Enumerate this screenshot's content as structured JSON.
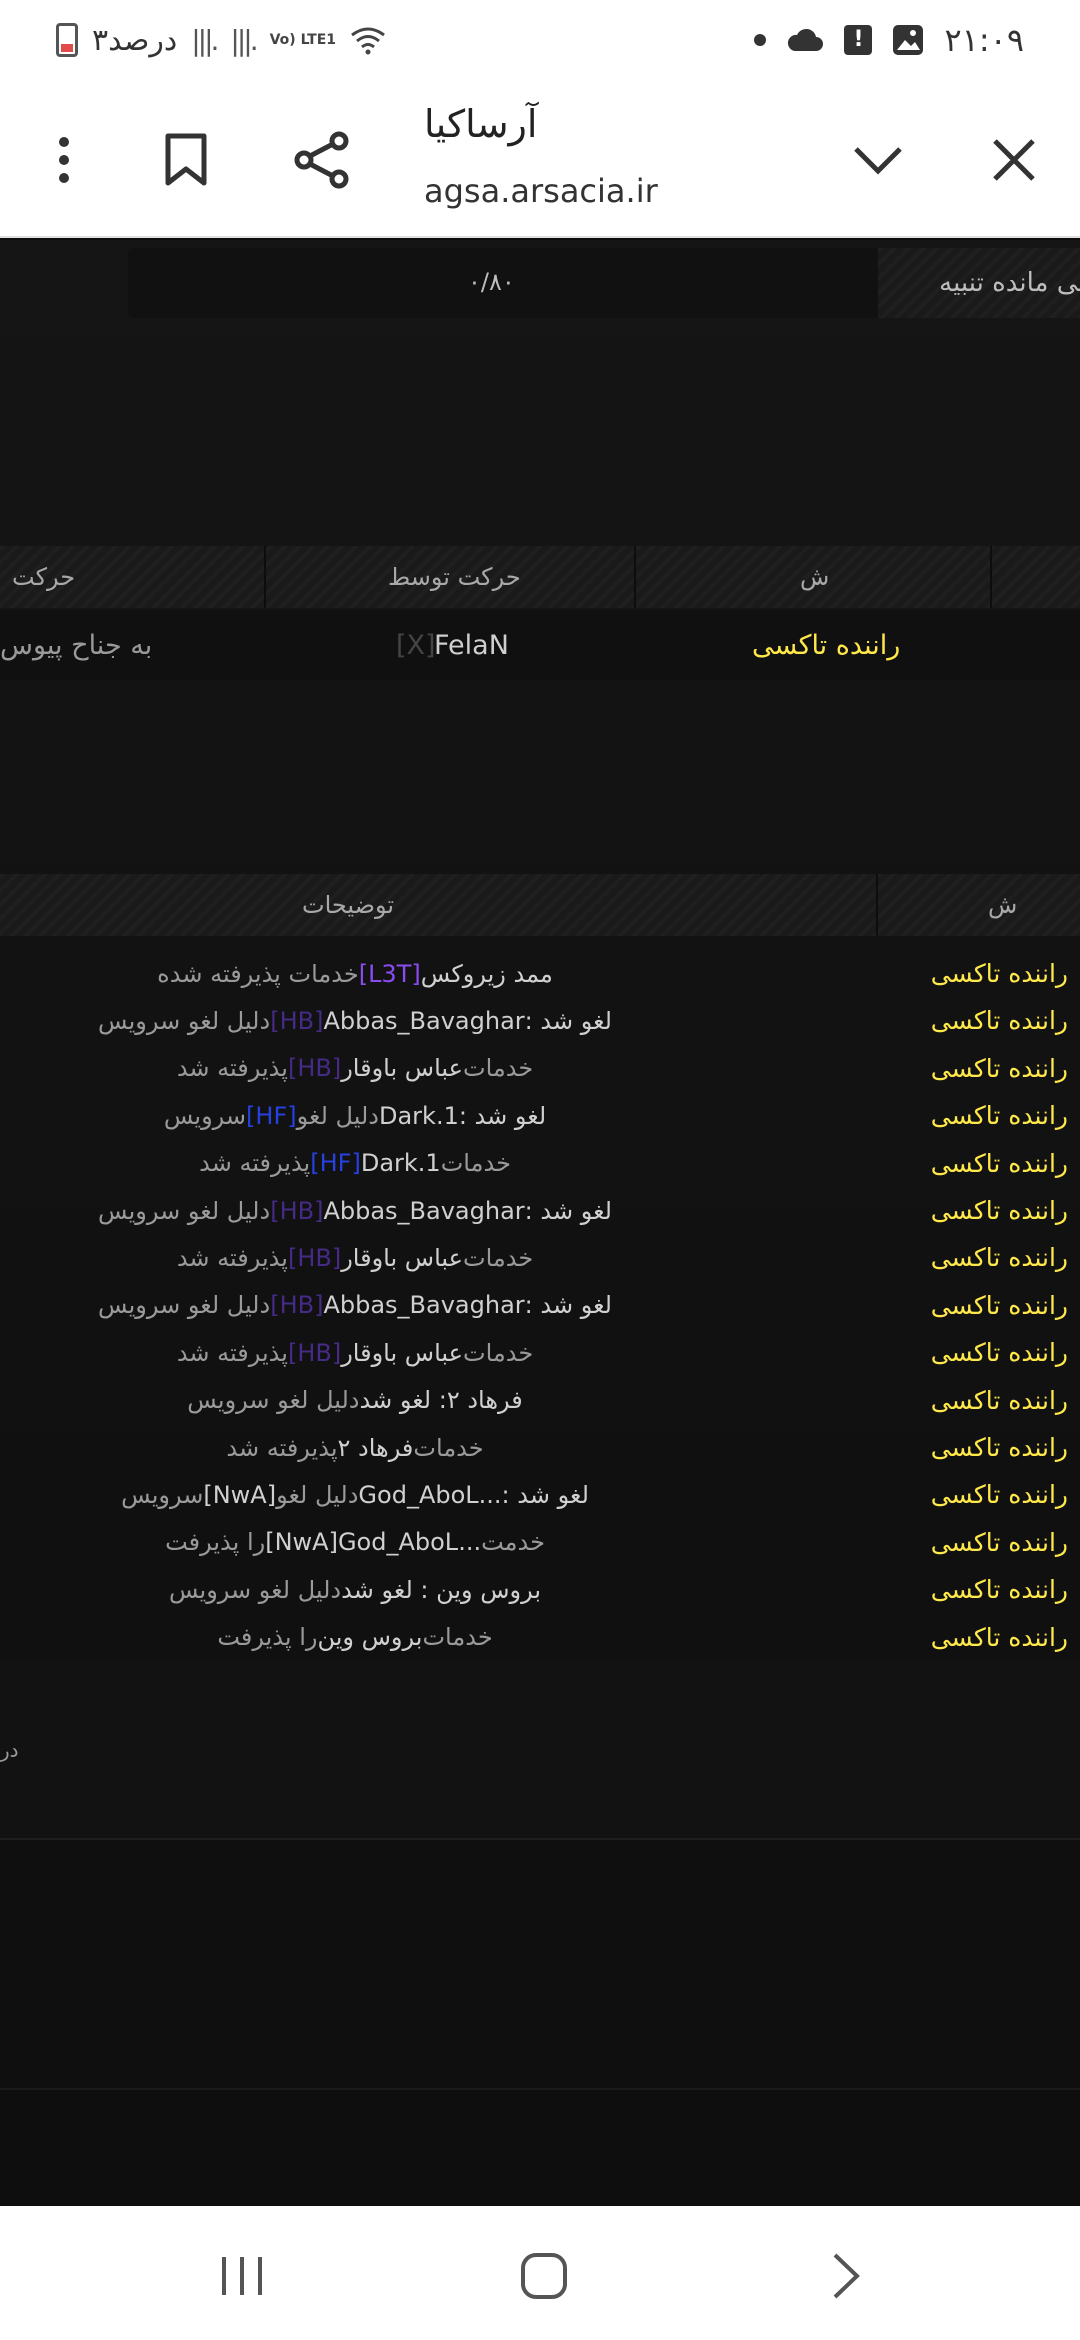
{
  "status_bar": {
    "battery_text": "۳درصد",
    "network": "Vo) LTE1",
    "time": "۲۱:۰۹",
    "icons": [
      "battery-icon",
      "signal-icon",
      "wifi-icon",
      "cloud-icon",
      "alert-icon",
      "gallery-icon"
    ]
  },
  "browser": {
    "title": "آرساکیا",
    "url": "agsa.arsacia.ir",
    "icons": [
      "more-icon",
      "bookmark-icon",
      "share-icon",
      "chevron-down-icon",
      "close-icon"
    ]
  },
  "warning": {
    "label": "باقی مانده تنبیه",
    "value": "۰/۸۰"
  },
  "table1": {
    "headers": {
      "rank": "ش",
      "moved_by": "حرکت توسط",
      "action": "حرکت"
    },
    "row": {
      "rank": "راننده تاکسی",
      "tag": "[X]",
      "name": "FelaN",
      "action": "به جناح پیوس"
    }
  },
  "table2": {
    "headers": {
      "rank": "ش",
      "description": "توضیحات"
    },
    "rows": [
      {
        "role": "راننده تاکسی",
        "parts": [
          {
            "t": "ممد زیروکس ",
            "c": "nm"
          },
          {
            "t": "[L3T]",
            "c": "tg-purple"
          },
          {
            "t": " خدمات پذیرفته شده",
            "c": ""
          }
        ]
      },
      {
        "role": "راننده تاکسی",
        "parts": [
          {
            "t": "لغو شد : ",
            "c": "nm"
          },
          {
            "t": "Abbas_Bavaghar",
            "c": "nm"
          },
          {
            "t": " [HB] ",
            "c": "tg-dim"
          },
          {
            "t": "دلیل لغو سرویس",
            "c": ""
          }
        ]
      },
      {
        "role": "راننده تاکسی",
        "parts": [
          {
            "t": "خدمات ",
            "c": ""
          },
          {
            "t": "عباس باوقار",
            "c": "nm"
          },
          {
            "t": " [HB] ",
            "c": "tg-dim"
          },
          {
            "t": "پذیرفته شد",
            "c": ""
          }
        ]
      },
      {
        "role": "راننده تاکسی",
        "parts": [
          {
            "t": "لغو شد : ",
            "c": "nm"
          },
          {
            "t": "Dark.1",
            "c": "nm"
          },
          {
            "t": " دلیل لغو ",
            "c": ""
          },
          {
            "t": "[HF]",
            "c": "tg-blue"
          },
          {
            "t": " سرویس",
            "c": ""
          }
        ]
      },
      {
        "role": "راننده تاکسی",
        "parts": [
          {
            "t": "خدمات ",
            "c": ""
          },
          {
            "t": "Dark.1",
            "c": "nm"
          },
          {
            "t": " [HF] ",
            "c": "tg-blue"
          },
          {
            "t": "پذیرفته شد",
            "c": ""
          }
        ]
      },
      {
        "role": "راننده تاکسی",
        "parts": [
          {
            "t": "لغو شد : ",
            "c": "nm"
          },
          {
            "t": "Abbas_Bavaghar",
            "c": "nm"
          },
          {
            "t": " [HB] ",
            "c": "tg-dim"
          },
          {
            "t": "دلیل لغو سرویس",
            "c": ""
          }
        ]
      },
      {
        "role": "راننده تاکسی",
        "parts": [
          {
            "t": "خدمات ",
            "c": ""
          },
          {
            "t": "عباس باوقار",
            "c": "nm"
          },
          {
            "t": " [HB] ",
            "c": "tg-dim"
          },
          {
            "t": "پذیرفته شد",
            "c": ""
          }
        ]
      },
      {
        "role": "راننده تاکسی",
        "parts": [
          {
            "t": "لغو شد : ",
            "c": "nm"
          },
          {
            "t": "Abbas_Bavaghar",
            "c": "nm"
          },
          {
            "t": " [HB] ",
            "c": "tg-dim"
          },
          {
            "t": "دلیل لغو سرویس",
            "c": ""
          }
        ]
      },
      {
        "role": "راننده تاکسی",
        "parts": [
          {
            "t": "خدمات ",
            "c": ""
          },
          {
            "t": "عباس باوقار",
            "c": "nm"
          },
          {
            "t": " [HB] ",
            "c": "tg-dim"
          },
          {
            "t": "پذیرفته شد",
            "c": ""
          }
        ]
      },
      {
        "role": "راننده تاکسی",
        "parts": [
          {
            "t": "فرهاد ۲: لغو شد ",
            "c": "nm"
          },
          {
            "t": "دلیل لغو سرویس",
            "c": ""
          }
        ]
      },
      {
        "role": "راننده تاکسی",
        "parts": [
          {
            "t": "خدمات ",
            "c": ""
          },
          {
            "t": "فرهاد ۲",
            "c": "nm"
          },
          {
            "t": " پذیرفته شد",
            "c": ""
          }
        ]
      },
      {
        "role": "راننده تاکسی",
        "parts": [
          {
            "t": "لغو شد : ",
            "c": "nm"
          },
          {
            "t": "...God_AboL",
            "c": "nm"
          },
          {
            "t": " دلیل لغو ",
            "c": ""
          },
          {
            "t": "[NwA]",
            "c": "nm"
          },
          {
            "t": " سرویس",
            "c": ""
          }
        ]
      },
      {
        "role": "راننده تاکسی",
        "parts": [
          {
            "t": "خدمت ",
            "c": ""
          },
          {
            "t": "...God_AboL",
            "c": "nm"
          },
          {
            "t": " [NwA] ",
            "c": "nm"
          },
          {
            "t": "را پذیرفت",
            "c": ""
          }
        ]
      },
      {
        "role": "راننده تاکسی",
        "parts": [
          {
            "t": "بروس وین : لغو شد ",
            "c": "nm"
          },
          {
            "t": "دلیل لغو سرویس",
            "c": ""
          }
        ]
      },
      {
        "role": "راننده تاکسی",
        "parts": [
          {
            "t": "خدمات ",
            "c": ""
          },
          {
            "t": "بروس وین",
            "c": "nm"
          },
          {
            "t": " را پذیرفت",
            "c": ""
          }
        ]
      }
    ]
  },
  "edge_text": "در",
  "nav": {
    "icons": [
      "recent-apps-icon",
      "home-icon",
      "back-icon"
    ]
  },
  "colors": {
    "rank": "#ffe84a",
    "tag_purple": "#8a4cf0",
    "tag_blue": "#2740e0",
    "tag_dim": "#452a86"
  }
}
